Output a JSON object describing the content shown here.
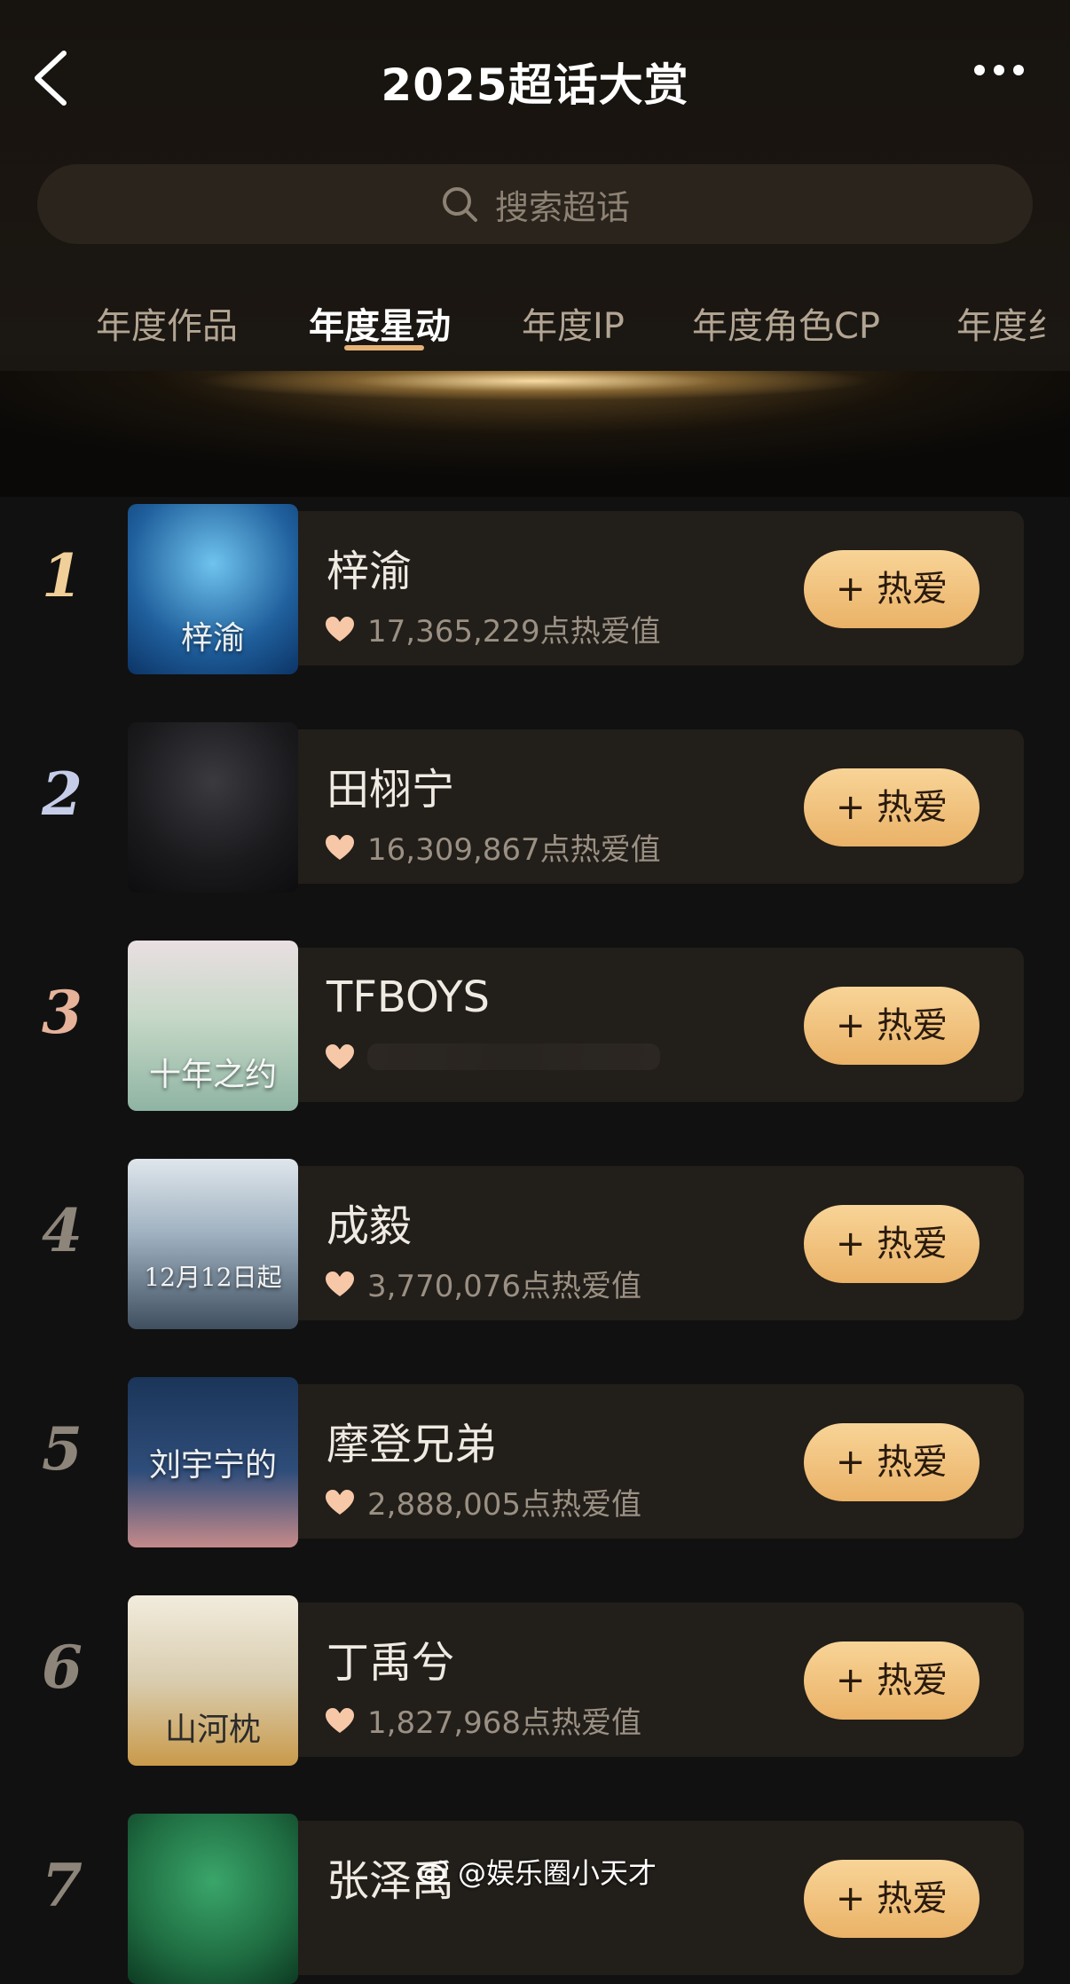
{
  "header": {
    "title": "2025超话大赏"
  },
  "search": {
    "placeholder": "搜索超话"
  },
  "tabs": [
    {
      "label": "年度作品",
      "active": false
    },
    {
      "label": "年度星动",
      "active": true
    },
    {
      "label": "年度IP",
      "active": false
    },
    {
      "label": "年度角色CP",
      "active": false
    },
    {
      "label": "年度纟",
      "active": false
    }
  ],
  "love_button_label": "+ 热爱",
  "ranking": [
    {
      "rank": "1",
      "name": "梓渝",
      "score": "17,365,229点热爱值",
      "thumb_text": "梓渝"
    },
    {
      "rank": "2",
      "name": "田栩宁",
      "score": "16,309,867点热爱值",
      "thumb_text": ""
    },
    {
      "rank": "3",
      "name": "TFBOYS",
      "score": "",
      "thumb_text": "十年之约"
    },
    {
      "rank": "4",
      "name": "成毅",
      "score": "3,770,076点热爱值",
      "thumb_text": "12月12日起"
    },
    {
      "rank": "5",
      "name": "摩登兄弟",
      "score": "2,888,005点热爱值",
      "thumb_text": "刘宇宁的"
    },
    {
      "rank": "6",
      "name": "丁禹兮",
      "score": "1,827,968点热爱值",
      "thumb_text": "山河枕"
    },
    {
      "rank": "7",
      "name": "张泽禹",
      "score": "",
      "thumb_text": ""
    }
  ],
  "watermark": "@娱乐圈小天才",
  "colors": {
    "accent_gold": "#eab267",
    "tab_underline": "#e6b376",
    "background": "#111111",
    "card": "#221e1a"
  }
}
